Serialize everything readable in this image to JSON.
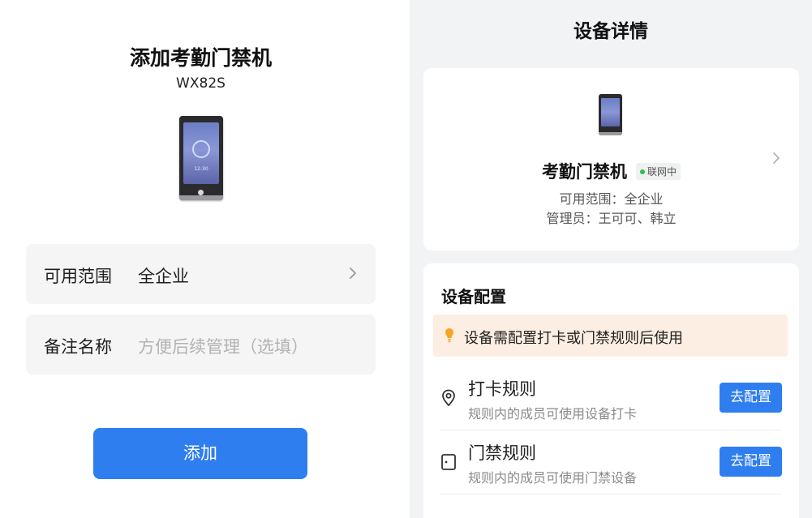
{
  "add_page": {
    "title": "添加考勤门禁机",
    "model": "WX82S",
    "device_screen_time": "12:30",
    "scope": {
      "label": "可用范围",
      "value": "全企业"
    },
    "remark": {
      "label": "备注名称",
      "placeholder": "方便后续管理（选填）"
    },
    "add_button": "添加"
  },
  "detail_page": {
    "title": "设备详情",
    "device": {
      "name": "考勤门禁机",
      "status": "联网中",
      "scope_line": "可用范围：全企业",
      "admin_line": "管理员：王可可、韩立"
    },
    "config": {
      "title": "设备配置",
      "warning": "设备需配置打卡或门禁规则后使用",
      "rules": [
        {
          "name": "打卡规则",
          "desc": "规则内的成员可使用设备打卡",
          "button": "去配置"
        },
        {
          "name": "门禁规则",
          "desc": "规则内的成员可使用门禁设备",
          "button": "去配置"
        }
      ]
    }
  },
  "colors": {
    "primary": "#2e7ef0",
    "online": "#2fbf4c",
    "warning_bg": "#fdeee3",
    "warning_icon": "#f5a623",
    "panel_bg": "#f2f3f5"
  },
  "icons": {
    "scope_chevron": "chevron-right-icon",
    "card_chevron": "chevron-right-icon",
    "warning": "lightbulb-icon",
    "punch_rule": "location-pin-icon",
    "door_rule": "door-icon"
  }
}
